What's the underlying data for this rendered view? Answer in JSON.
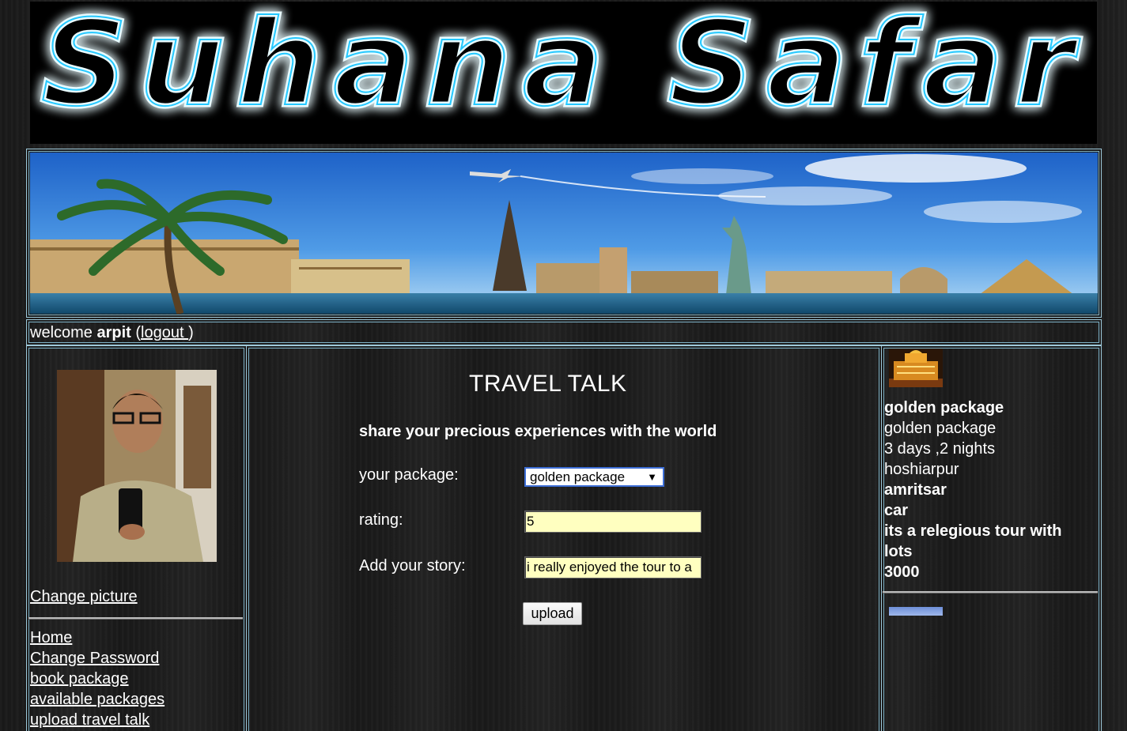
{
  "site": {
    "logo_text": "Suhana Safar"
  },
  "user_bar": {
    "welcome_prefix": "welcome ",
    "username": "arpit",
    "open_paren": " (",
    "logout_label": "logout ",
    "close_paren": ")"
  },
  "sidebar": {
    "change_picture_label": "Change picture",
    "menu": [
      {
        "label": "Home "
      },
      {
        "label": "Change Password"
      },
      {
        "label": "book package "
      },
      {
        "label": "available packages"
      },
      {
        "label": "upload travel talk"
      }
    ]
  },
  "travel_talk": {
    "title": "TRAVEL TALK",
    "subtitle": "share your precious experiences with the world",
    "package_label": "your package:",
    "package_value": "golden package",
    "rating_label": "rating:",
    "rating_value": "5",
    "story_label": "Add your story:",
    "story_value": "i really enjoyed the tour to a",
    "upload_label": "upload"
  },
  "package_card": {
    "name_bold": "golden package",
    "name": "golden package",
    "duration": "3 days ,2 nights",
    "from": "hoshiarpur",
    "to": "amritsar",
    "transport": "car",
    "description": "its a relegious tour with lots",
    "price": "3000"
  },
  "colors": {
    "frame_border": "#9ec9da",
    "select_border": "#3d6ed6",
    "input_bg": "#ffffc0",
    "logo_glow": "#24c8ff"
  }
}
